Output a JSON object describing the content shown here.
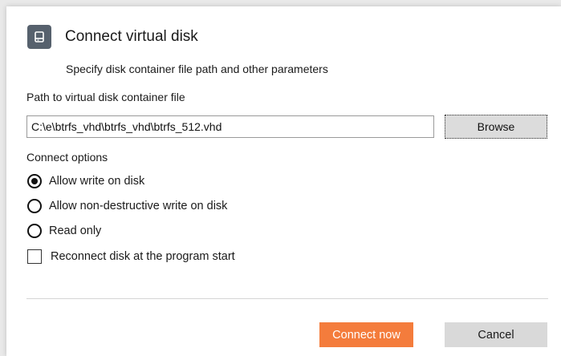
{
  "dialog": {
    "title": "Connect virtual disk",
    "subtitle": "Specify disk container file path and other parameters",
    "icon": "disk-icon",
    "accent_color": "#f47c3c",
    "icon_bg_color": "#56616d"
  },
  "path": {
    "label": "Path to virtual disk container file",
    "value": "C:\\e\\btrfs_vhd\\btrfs_vhd\\btrfs_512.vhd",
    "browse_label": "Browse"
  },
  "options": {
    "label": "Connect options",
    "radios": [
      {
        "label": "Allow write on disk",
        "checked": true
      },
      {
        "label": "Allow non-destructive write on disk",
        "checked": false
      },
      {
        "label": "Read only",
        "checked": false
      }
    ],
    "reconnect": {
      "label": "Reconnect disk at the program start",
      "checked": false
    }
  },
  "footer": {
    "connect_label": "Connect now",
    "cancel_label": "Cancel"
  }
}
